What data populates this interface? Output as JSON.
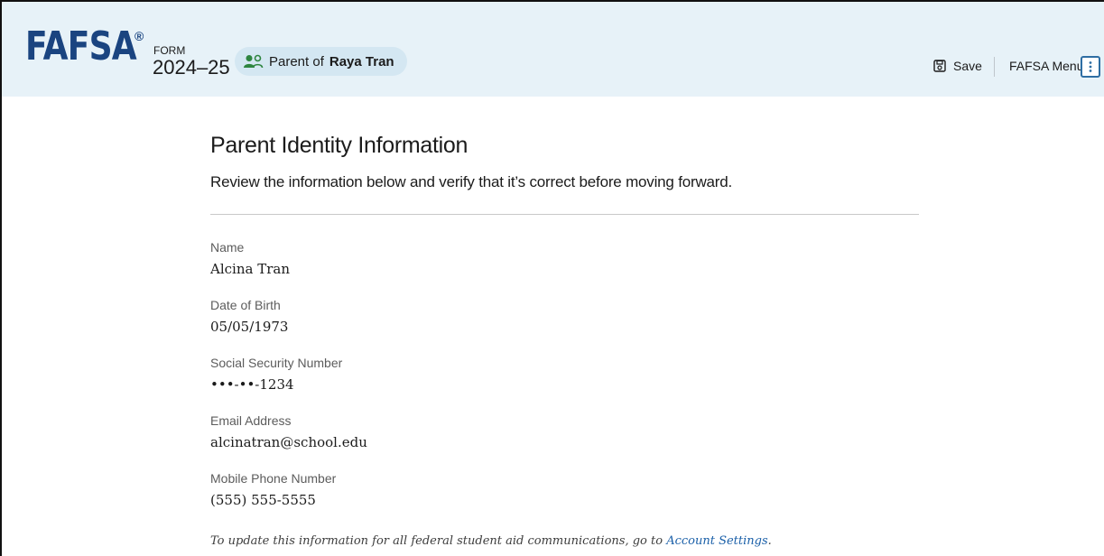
{
  "header": {
    "logo": "FAFSA",
    "logo_mark": "®",
    "form_label": "FORM",
    "form_year": "2024–25",
    "role_prefix": "Parent of",
    "role_name": "Raya Tran",
    "role_icon": "people-icon",
    "save_label": "Save",
    "save_icon": "save-icon",
    "menu_label": "FAFSA Menu",
    "menu_icon": "kebab-icon",
    "background": "#e7f2f8"
  },
  "main": {
    "title": "Parent Identity Information",
    "subtitle": "Review the information below and verify that it’s correct before moving forward.",
    "fields": [
      {
        "label": "Name",
        "value": "Alcina Tran"
      },
      {
        "label": "Date of Birth",
        "value": "05/05/1973"
      },
      {
        "label": "Social Security Number",
        "value": "•••-••-1234"
      },
      {
        "label": "Email Address",
        "value": "alcinatran@school.edu"
      },
      {
        "label": "Mobile Phone Number",
        "value": "(555) 555-5555"
      }
    ],
    "note_text": "To update this information for all federal student aid communications, go to",
    "note_link": "Account Settings",
    "note_end": "."
  },
  "colors": {
    "brand": "#1a4480",
    "link": "#1a5fa8",
    "pill": "#d4e7f2"
  }
}
